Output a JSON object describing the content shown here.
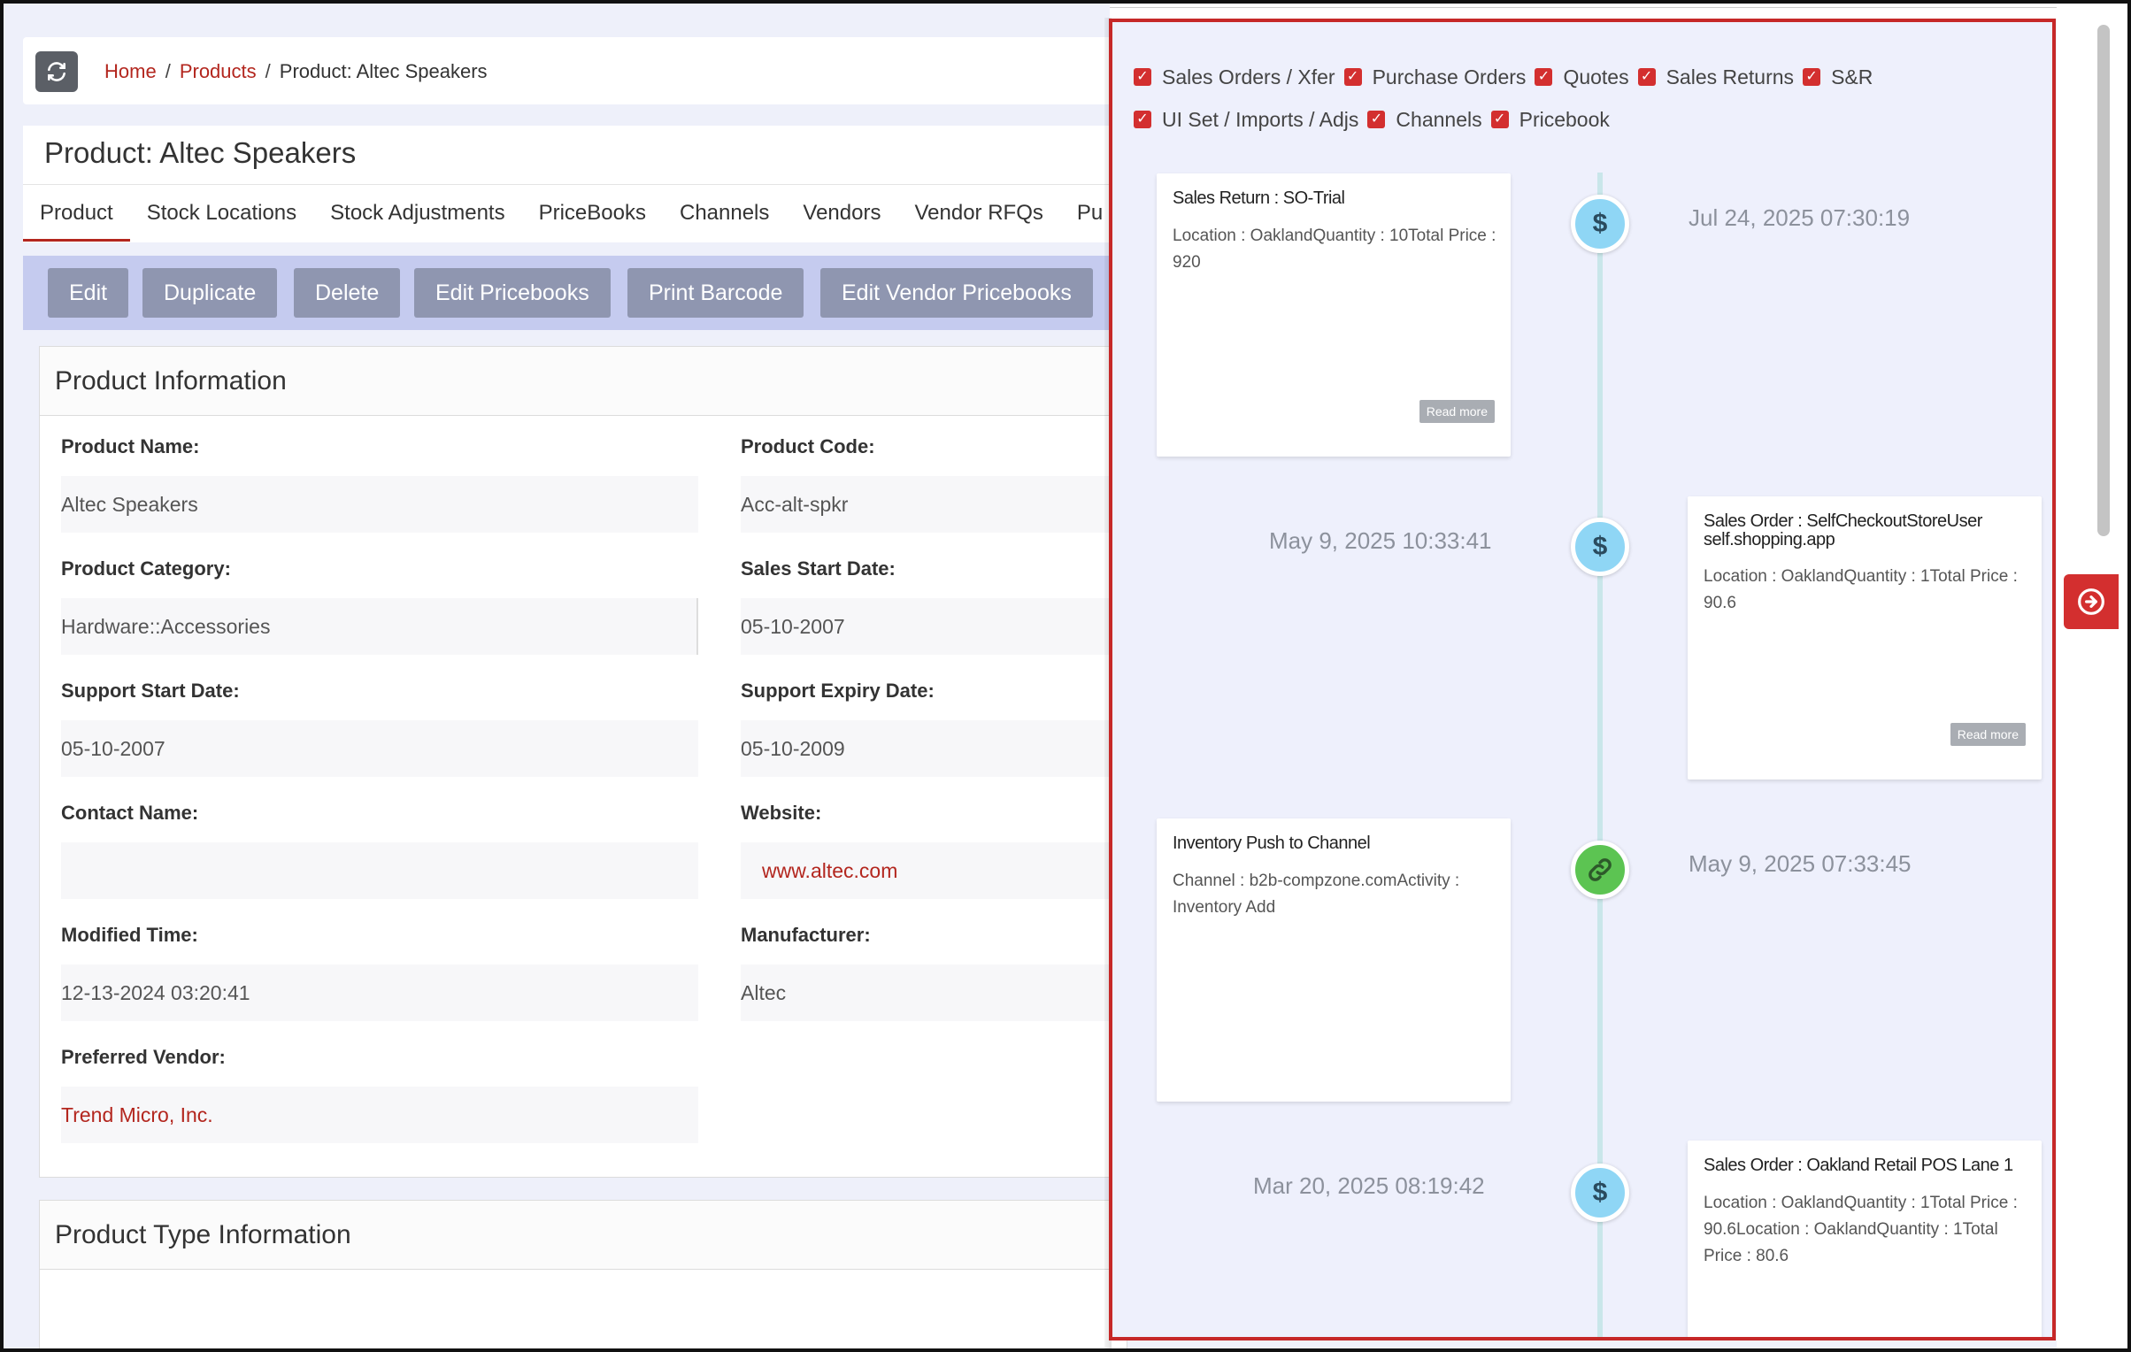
{
  "breadcrumb": {
    "home": "Home",
    "products": "Products",
    "current": "Product: Altec Speakers"
  },
  "page_title": "Product: Altec Speakers",
  "tabs": [
    "Product",
    "Stock Locations",
    "Stock Adjustments",
    "PriceBooks",
    "Channels",
    "Vendors",
    "Vendor RFQs",
    "Pu"
  ],
  "toolbar": {
    "edit": "Edit",
    "duplicate": "Duplicate",
    "delete": "Delete",
    "edit_pricebooks": "Edit Pricebooks",
    "print_barcode": "Print Barcode",
    "edit_vendor_pricebooks": "Edit Vendor Pricebooks"
  },
  "product_info": {
    "heading": "Product Information",
    "product_name_label": "Product Name:",
    "product_name": "Altec Speakers",
    "product_code_label": "Product Code:",
    "product_code": "Acc-alt-spkr",
    "category_label": "Product Category:",
    "category": "Hardware::Accessories",
    "sales_start_label": "Sales Start Date:",
    "sales_start": "05-10-2007",
    "support_start_label": "Support Start Date:",
    "support_start": "05-10-2007",
    "support_expiry_label": "Support Expiry Date:",
    "support_expiry": "05-10-2009",
    "contact_label": "Contact Name:",
    "contact": "",
    "website_label": "Website:",
    "website": "www.altec.com",
    "modified_label": "Modified Time:",
    "modified": "12-13-2024 03:20:41",
    "manufacturer_label": "Manufacturer:",
    "manufacturer": "Altec",
    "vendor_label": "Preferred Vendor:",
    "vendor": "Trend Micro, Inc."
  },
  "product_type": {
    "heading": "Product Type Information"
  },
  "filters": {
    "row1": [
      "Sales Orders / Xfer",
      "Purchase Orders",
      "Quotes",
      "Sales Returns",
      "S&R"
    ],
    "row2": [
      "UI Set / Imports / Adjs",
      "Channels",
      "Pricebook"
    ]
  },
  "timeline": [
    {
      "date": "Jul 24, 2025 07:30:19",
      "title": "Sales Return : SO-Trial",
      "body": "Location : OaklandQuantity : 10Total Price : 920",
      "read_more": "Read more",
      "icon": "dollar-icon"
    },
    {
      "date": "May 9, 2025 10:33:41",
      "title": "Sales Order : SelfCheckoutStoreUser self.shopping.app",
      "body": "Location : OaklandQuantity : 1Total Price : 90.6",
      "read_more": "Read more",
      "icon": "dollar-icon"
    },
    {
      "date": "May 9, 2025 07:33:45",
      "title": "Inventory Push to Channel",
      "body": "Channel : b2b-compzone.comActivity : Inventory Add",
      "icon": "link-icon"
    },
    {
      "date": "Mar 20, 2025 08:19:42",
      "title": "Sales Order : Oakland Retail POS Lane 1",
      "body": "Location : OaklandQuantity : 1Total Price : 90.6Location : OaklandQuantity : 1Total Price : 80.6",
      "icon": "dollar-icon"
    }
  ],
  "icons": {
    "refresh": "refresh-icon",
    "dollar": "$",
    "collapse": "arrow-right-circle-icon"
  },
  "colors": {
    "accent": "#b3261e",
    "panel_border": "#c62828",
    "toolbar_bg": "#c5cbef",
    "button": "#8f96b0"
  }
}
